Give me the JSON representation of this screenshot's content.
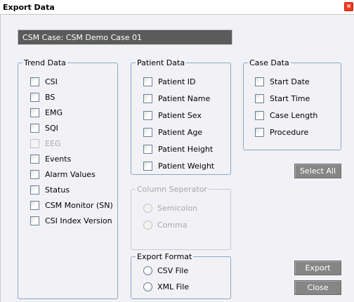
{
  "window": {
    "title": "Export Data",
    "close_glyph": "×"
  },
  "case_field": {
    "value": "CSM Case: CSM Demo Case 01"
  },
  "trend_data": {
    "legend": "Trend Data",
    "items": [
      {
        "label": "CSI",
        "enabled": true
      },
      {
        "label": "BS",
        "enabled": true
      },
      {
        "label": "EMG",
        "enabled": true
      },
      {
        "label": "SQI",
        "enabled": true
      },
      {
        "label": "EEG",
        "enabled": false
      },
      {
        "label": "Events",
        "enabled": true
      },
      {
        "label": "Alarm Values",
        "enabled": true
      },
      {
        "label": "Status",
        "enabled": true
      },
      {
        "label": "CSM Monitor (SN)",
        "enabled": true
      },
      {
        "label": "CSI Index Version",
        "enabled": true
      }
    ]
  },
  "patient_data": {
    "legend": "Patient Data",
    "items": [
      {
        "label": "Patient ID"
      },
      {
        "label": "Patient Name"
      },
      {
        "label": "Patient Sex"
      },
      {
        "label": "Patient Age"
      },
      {
        "label": "Patient Height"
      },
      {
        "label": "Patient Weight"
      }
    ]
  },
  "case_data": {
    "legend": "Case Data",
    "items": [
      {
        "label": "Start Date"
      },
      {
        "label": "Start Time"
      },
      {
        "label": "Case Length"
      },
      {
        "label": "Procedure"
      }
    ]
  },
  "column_separator": {
    "legend": "Column Seperator",
    "options": [
      {
        "label": "Semicolon"
      },
      {
        "label": "Comma"
      }
    ]
  },
  "export_format": {
    "legend": "Export Format",
    "options": [
      {
        "label": "CSV File"
      },
      {
        "label": "XML File"
      }
    ]
  },
  "buttons": {
    "select_all": "Select All",
    "export": "Export",
    "close": "Close"
  }
}
